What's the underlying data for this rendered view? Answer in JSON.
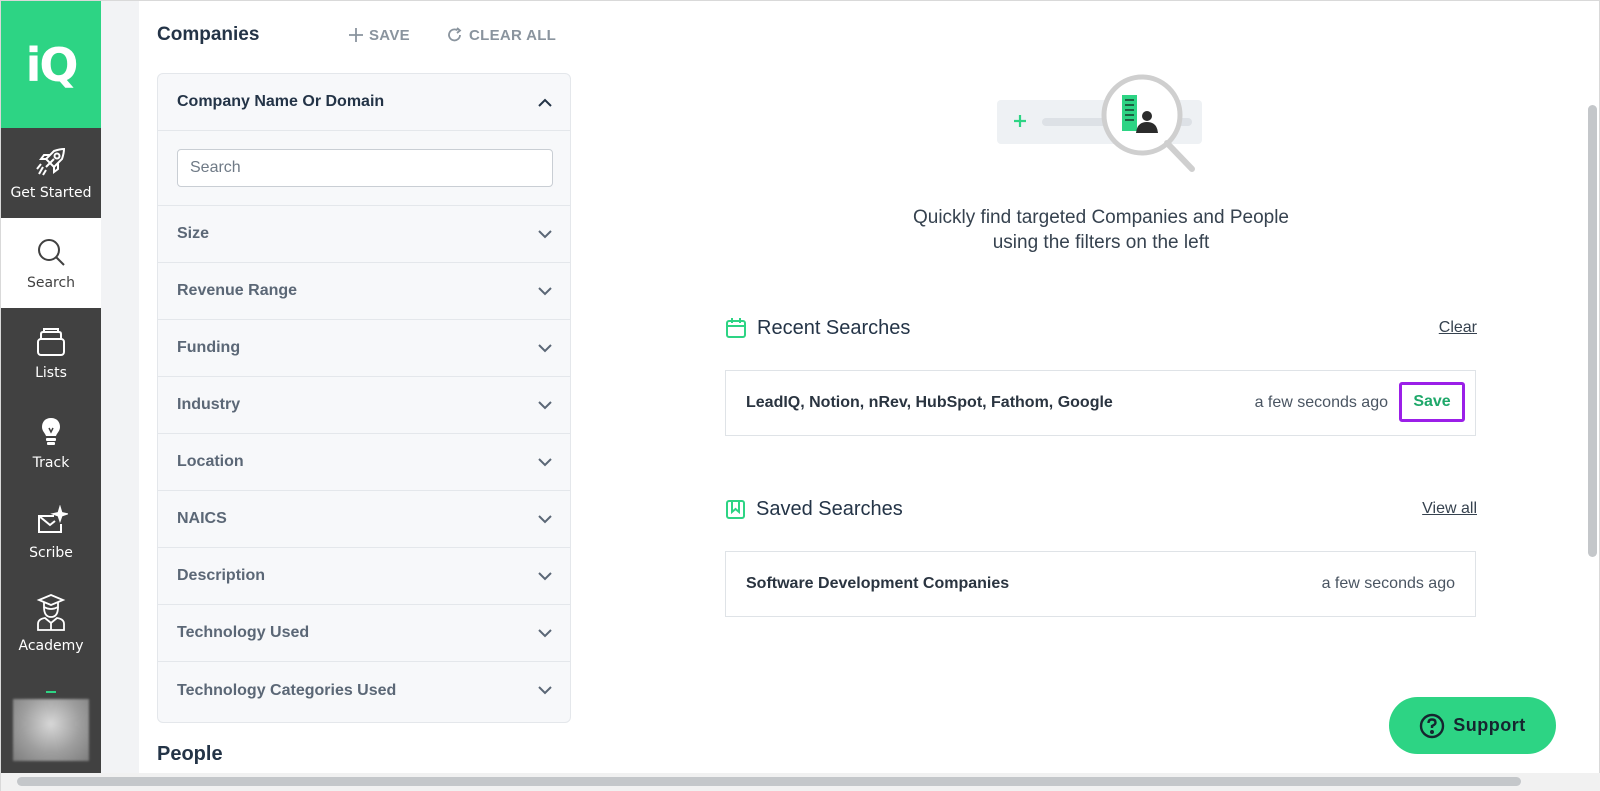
{
  "nav": {
    "logo": "iQ",
    "items": [
      {
        "label": "Get Started",
        "icon": "rocket-icon"
      },
      {
        "label": "Search",
        "icon": "search-icon"
      },
      {
        "label": "Lists",
        "icon": "lists-icon"
      },
      {
        "label": "Track",
        "icon": "lightbulb-icon"
      },
      {
        "label": "Scribe",
        "icon": "mail-sparkle-icon"
      },
      {
        "label": "Academy",
        "icon": "graduate-icon"
      }
    ],
    "active": "Search"
  },
  "filters": {
    "title": "Companies",
    "save_label": "SAVE",
    "clear_label": "CLEAR ALL",
    "open_filter": "Company Name Or Domain",
    "search_placeholder": "Search",
    "rows": [
      "Size",
      "Revenue Range",
      "Funding",
      "Industry",
      "Location",
      "NAICS",
      "Description",
      "Technology Used",
      "Technology Categories Used"
    ],
    "people_title": "People"
  },
  "main": {
    "tagline_line1": "Quickly find targeted Companies and People",
    "tagline_line2": "using the filters on the left",
    "recent": {
      "title": "Recent Searches",
      "link": "Clear",
      "item": {
        "title": "LeadIQ, Notion, nRev, HubSpot, Fathom, Google",
        "time": "a few seconds ago",
        "save_label": "Save"
      }
    },
    "saved": {
      "title": "Saved Searches",
      "link": "View all",
      "item": {
        "title": "Software Development Companies",
        "time": "a few seconds ago"
      }
    }
  },
  "support": {
    "label": "Support"
  },
  "colors": {
    "brand_green": "#2dd484",
    "nav_dark": "#414141",
    "highlight_purple": "#9b1fe8"
  }
}
